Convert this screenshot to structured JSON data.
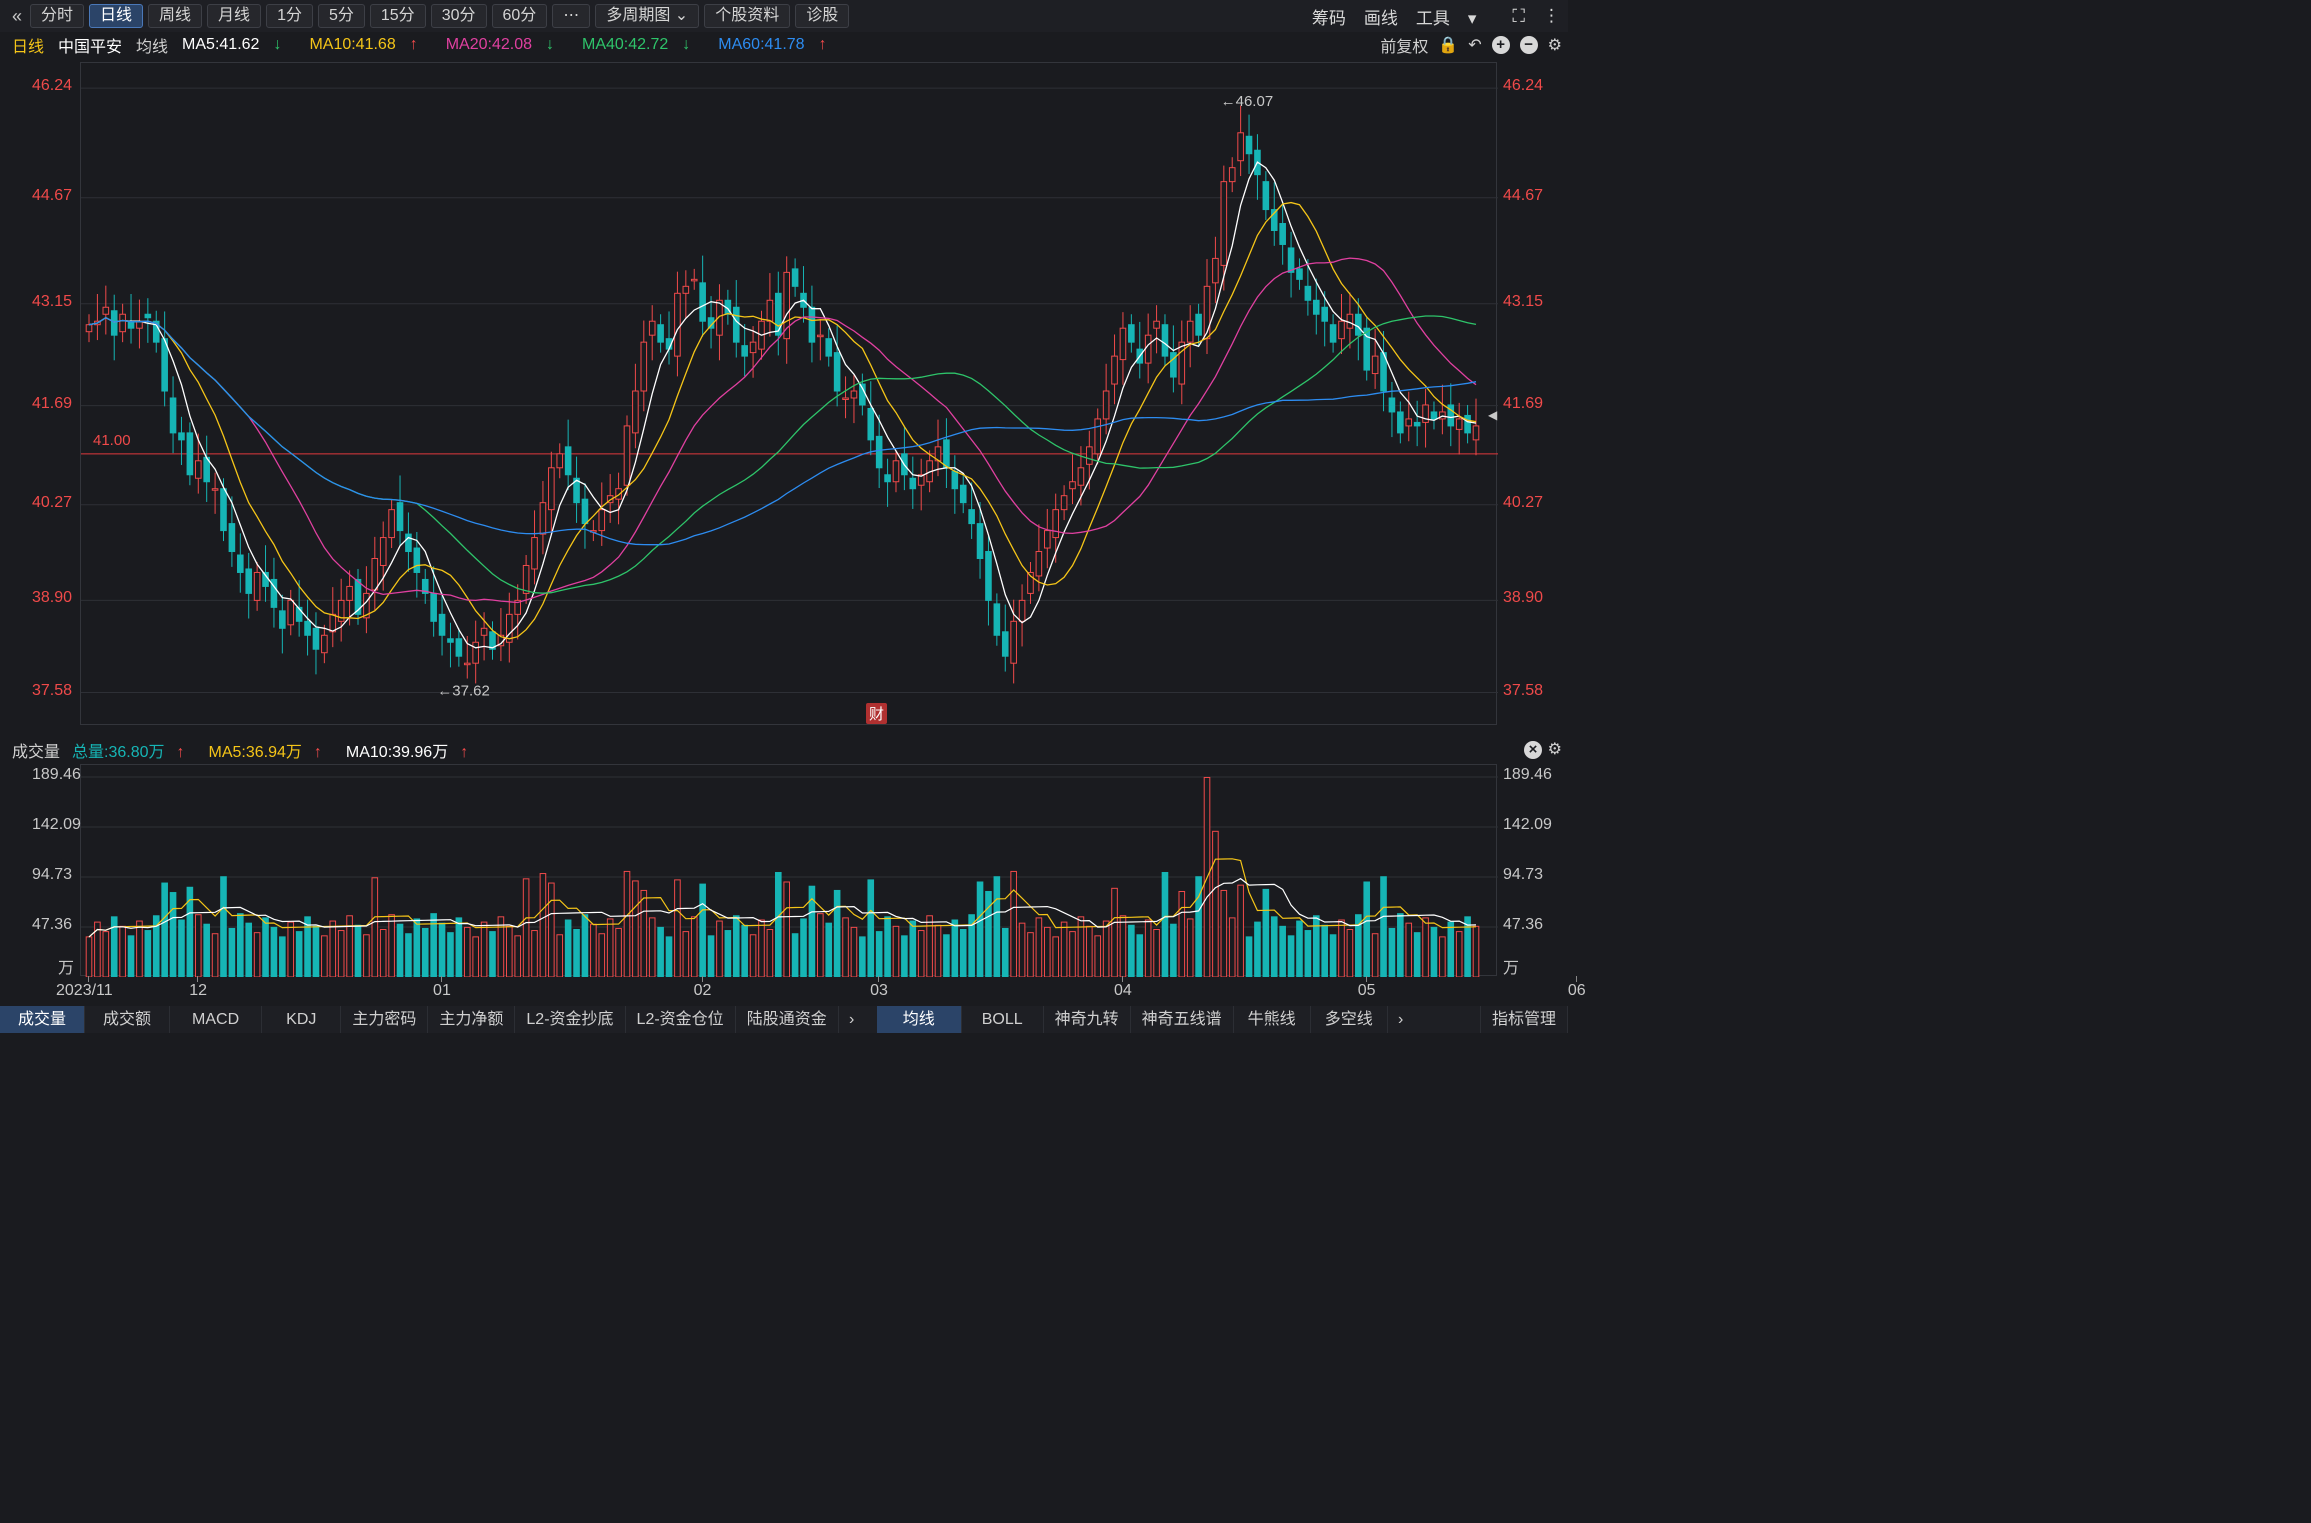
{
  "toolbar": {
    "buttons": [
      "分时",
      "日线",
      "周线",
      "月线",
      "1分",
      "5分",
      "15分",
      "30分",
      "60分",
      "⋯",
      "多周期图",
      "个股资料",
      "诊股"
    ],
    "active_index": 1,
    "right": [
      "筹码",
      "画线",
      "工具"
    ]
  },
  "info": {
    "period": "日线",
    "stock": "中国平安",
    "ma_label": "均线",
    "ma5": "MA5:41.62",
    "ma10": "MA10:41.68",
    "ma20": "MA20:42.08",
    "ma40": "MA40:42.72",
    "ma60": "MA60:41.78",
    "adjust": "前复权"
  },
  "volume_info": {
    "title": "成交量",
    "total": "总量:36.80万",
    "ma5": "MA5:36.94万",
    "ma10": "MA10:39.96万"
  },
  "colors": {
    "up": "#f04a4a",
    "down": "#16b5b5",
    "ma5": "#ffffff",
    "ma10": "#f5c518",
    "ma20": "#e040a0",
    "ma40": "#2ec46a",
    "ma60": "#2d8cf0"
  },
  "price_axis": [
    "46.24",
    "44.67",
    "43.15",
    "41.69",
    "40.27",
    "38.90",
    "37.58"
  ],
  "price_line_label": "41.00",
  "high_label": "←46.07",
  "low_label": "←37.62",
  "event_marker": "财",
  "volume_axis": [
    "189.46",
    "142.09",
    "94.73",
    "47.36",
    "万"
  ],
  "dates": [
    "2023/11",
    "12",
    "01",
    "02",
    "03",
    "04",
    "05",
    "06"
  ],
  "bottom_tabs": [
    "成交量",
    "成交额",
    "MACD",
    "KDJ",
    "主力密码",
    "主力净额",
    "L2-资金抄底",
    "L2-资金仓位",
    "陆股通资金"
  ],
  "bottom_tabs2": [
    "均线",
    "BOLL",
    "神奇九转",
    "神奇五线谱",
    "牛熊线",
    "多空线"
  ],
  "indicator_manage": "指标管理",
  "chart_data": {
    "type": "candlestick",
    "price_range": [
      37.1,
      46.6
    ],
    "volume_range": [
      0,
      189.46
    ],
    "price_ref_line": 41.0,
    "candles_close": [
      42.85,
      42.9,
      43.1,
      42.7,
      43.0,
      42.8,
      42.9,
      42.95,
      42.6,
      41.9,
      41.3,
      41.2,
      40.7,
      40.9,
      40.6,
      40.5,
      39.9,
      39.6,
      39.3,
      39.0,
      39.3,
      39.1,
      38.8,
      38.5,
      38.9,
      38.6,
      38.4,
      38.2,
      38.4,
      38.7,
      38.9,
      39.1,
      38.7,
      39.0,
      39.5,
      39.8,
      40.2,
      39.9,
      39.6,
      39.3,
      39.0,
      38.6,
      38.4,
      38.3,
      38.1,
      38.0,
      38.3,
      38.5,
      38.2,
      38.4,
      38.7,
      38.9,
      39.4,
      39.8,
      40.3,
      40.8,
      41.0,
      40.7,
      40.3,
      40.0,
      39.9,
      40.2,
      40.4,
      40.5,
      41.4,
      41.9,
      42.6,
      42.9,
      42.6,
      42.5,
      43.3,
      43.4,
      43.5,
      42.9,
      42.8,
      43.2,
      43.0,
      42.6,
      42.4,
      42.6,
      42.9,
      43.2,
      42.7,
      43.6,
      43.4,
      43.1,
      42.6,
      42.7,
      42.4,
      41.9,
      41.8,
      41.9,
      41.7,
      41.2,
      40.8,
      40.6,
      40.9,
      40.7,
      40.5,
      40.7,
      40.9,
      41.1,
      40.8,
      40.5,
      40.3,
      40.0,
      39.5,
      38.9,
      38.4,
      38.1,
      38.6,
      38.9,
      39.3,
      39.6,
      39.9,
      40.2,
      40.4,
      40.6,
      40.8,
      41.1,
      41.5,
      41.9,
      42.4,
      42.8,
      42.6,
      42.3,
      42.7,
      42.9,
      42.4,
      42.1,
      42.6,
      42.9,
      42.7,
      43.4,
      43.8,
      44.9,
      45.1,
      45.6,
      45.3,
      45.0,
      44.5,
      44.2,
      44.0,
      43.6,
      43.5,
      43.2,
      43.0,
      42.9,
      42.6,
      42.9,
      43.0,
      42.7,
      42.2,
      42.4,
      41.9,
      41.6,
      41.3,
      41.5,
      41.4,
      41.7,
      41.5,
      41.6,
      41.4,
      41.5,
      41.3,
      41.4
    ]
  }
}
